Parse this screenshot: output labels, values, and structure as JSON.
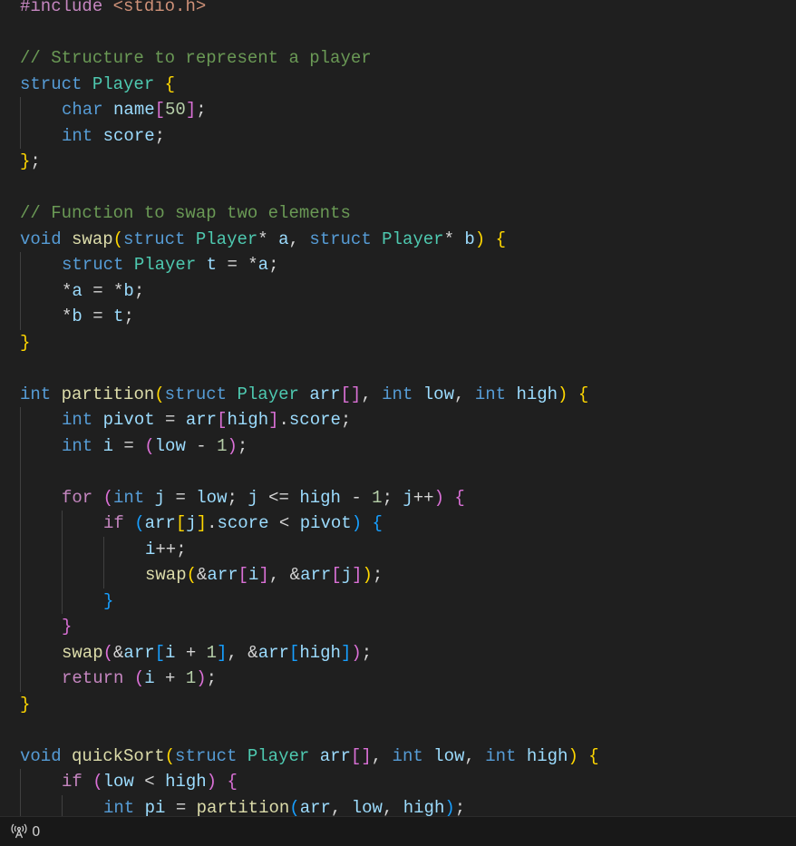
{
  "editor": {
    "lines": [
      [
        [
          "#include",
          "c"
        ],
        [
          " ",
          "p"
        ],
        [
          "<stdio.h>",
          "s"
        ]
      ],
      [],
      [
        [
          "// Structure to represent a player",
          "cm"
        ]
      ],
      [
        [
          "struct",
          "k"
        ],
        [
          " ",
          "p"
        ],
        [
          "Player",
          "t"
        ],
        [
          " ",
          "p"
        ],
        [
          "{",
          "b1"
        ]
      ],
      [
        [
          "    ",
          "i"
        ],
        [
          "char",
          "k"
        ],
        [
          " ",
          "p"
        ],
        [
          "name",
          "v"
        ],
        [
          "[",
          "b2"
        ],
        [
          "50",
          "n"
        ],
        [
          "]",
          "b2"
        ],
        [
          ";",
          "p"
        ]
      ],
      [
        [
          "    ",
          "i"
        ],
        [
          "int",
          "k"
        ],
        [
          " ",
          "p"
        ],
        [
          "score",
          "v"
        ],
        [
          ";",
          "p"
        ]
      ],
      [
        [
          "}",
          "b1"
        ],
        [
          ";",
          "p"
        ]
      ],
      [],
      [
        [
          "// Function to swap two elements",
          "cm"
        ]
      ],
      [
        [
          "void",
          "k"
        ],
        [
          " ",
          "p"
        ],
        [
          "swap",
          "f"
        ],
        [
          "(",
          "b1"
        ],
        [
          "struct",
          "k"
        ],
        [
          " ",
          "p"
        ],
        [
          "Player",
          "t"
        ],
        [
          "* ",
          "p"
        ],
        [
          "a",
          "v"
        ],
        [
          ", ",
          "p"
        ],
        [
          "struct",
          "k"
        ],
        [
          " ",
          "p"
        ],
        [
          "Player",
          "t"
        ],
        [
          "* ",
          "p"
        ],
        [
          "b",
          "v"
        ],
        [
          ")",
          "b1"
        ],
        [
          " ",
          "p"
        ],
        [
          "{",
          "b1"
        ]
      ],
      [
        [
          "    ",
          "i"
        ],
        [
          "struct",
          "k"
        ],
        [
          " ",
          "p"
        ],
        [
          "Player",
          "t"
        ],
        [
          " ",
          "p"
        ],
        [
          "t",
          "v"
        ],
        [
          " = *",
          "p"
        ],
        [
          "a",
          "v"
        ],
        [
          ";",
          "p"
        ]
      ],
      [
        [
          "    ",
          "i"
        ],
        [
          "*",
          "p"
        ],
        [
          "a",
          "v"
        ],
        [
          " = *",
          "p"
        ],
        [
          "b",
          "v"
        ],
        [
          ";",
          "p"
        ]
      ],
      [
        [
          "    ",
          "i"
        ],
        [
          "*",
          "p"
        ],
        [
          "b",
          "v"
        ],
        [
          " = ",
          "p"
        ],
        [
          "t",
          "v"
        ],
        [
          ";",
          "p"
        ]
      ],
      [
        [
          "}",
          "b1"
        ]
      ],
      [],
      [
        [
          "int",
          "k"
        ],
        [
          " ",
          "p"
        ],
        [
          "partition",
          "f"
        ],
        [
          "(",
          "b1"
        ],
        [
          "struct",
          "k"
        ],
        [
          " ",
          "p"
        ],
        [
          "Player",
          "t"
        ],
        [
          " ",
          "p"
        ],
        [
          "arr",
          "v"
        ],
        [
          "[]",
          "b2"
        ],
        [
          ", ",
          "p"
        ],
        [
          "int",
          "k"
        ],
        [
          " ",
          "p"
        ],
        [
          "low",
          "v"
        ],
        [
          ", ",
          "p"
        ],
        [
          "int",
          "k"
        ],
        [
          " ",
          "p"
        ],
        [
          "high",
          "v"
        ],
        [
          ")",
          "b1"
        ],
        [
          " ",
          "p"
        ],
        [
          "{",
          "b1"
        ]
      ],
      [
        [
          "    ",
          "i"
        ],
        [
          "int",
          "k"
        ],
        [
          " ",
          "p"
        ],
        [
          "pivot",
          "v"
        ],
        [
          " = ",
          "p"
        ],
        [
          "arr",
          "v"
        ],
        [
          "[",
          "b2"
        ],
        [
          "high",
          "v"
        ],
        [
          "]",
          "b2"
        ],
        [
          ".",
          "p"
        ],
        [
          "score",
          "v"
        ],
        [
          ";",
          "p"
        ]
      ],
      [
        [
          "    ",
          "i"
        ],
        [
          "int",
          "k"
        ],
        [
          " ",
          "p"
        ],
        [
          "i",
          "v"
        ],
        [
          " = ",
          "p"
        ],
        [
          "(",
          "b2"
        ],
        [
          "low",
          "v"
        ],
        [
          " - ",
          "p"
        ],
        [
          "1",
          "n"
        ],
        [
          ")",
          "b2"
        ],
        [
          ";",
          "p"
        ]
      ],
      [
        [
          "    ",
          "i"
        ]
      ],
      [
        [
          "    ",
          "i"
        ],
        [
          "for",
          "c"
        ],
        [
          " ",
          "p"
        ],
        [
          "(",
          "b2"
        ],
        [
          "int",
          "k"
        ],
        [
          " ",
          "p"
        ],
        [
          "j",
          "v"
        ],
        [
          " = ",
          "p"
        ],
        [
          "low",
          "v"
        ],
        [
          "; ",
          "p"
        ],
        [
          "j",
          "v"
        ],
        [
          " <= ",
          "p"
        ],
        [
          "high",
          "v"
        ],
        [
          " - ",
          "p"
        ],
        [
          "1",
          "n"
        ],
        [
          "; ",
          "p"
        ],
        [
          "j",
          "v"
        ],
        [
          "++",
          "p"
        ],
        [
          ")",
          "b2"
        ],
        [
          " ",
          "p"
        ],
        [
          "{",
          "b2"
        ]
      ],
      [
        [
          "    ",
          "i"
        ],
        [
          "    ",
          "i"
        ],
        [
          "if",
          "c"
        ],
        [
          " ",
          "p"
        ],
        [
          "(",
          "b3"
        ],
        [
          "arr",
          "v"
        ],
        [
          "[",
          "b1"
        ],
        [
          "j",
          "v"
        ],
        [
          "]",
          "b1"
        ],
        [
          ".",
          "p"
        ],
        [
          "score",
          "v"
        ],
        [
          " < ",
          "p"
        ],
        [
          "pivot",
          "v"
        ],
        [
          ")",
          "b3"
        ],
        [
          " ",
          "p"
        ],
        [
          "{",
          "b3"
        ]
      ],
      [
        [
          "    ",
          "i"
        ],
        [
          "    ",
          "i"
        ],
        [
          "    ",
          "i"
        ],
        [
          "i",
          "v"
        ],
        [
          "++;",
          "p"
        ]
      ],
      [
        [
          "    ",
          "i"
        ],
        [
          "    ",
          "i"
        ],
        [
          "    ",
          "i"
        ],
        [
          "swap",
          "f"
        ],
        [
          "(",
          "b1"
        ],
        [
          "&",
          "p"
        ],
        [
          "arr",
          "v"
        ],
        [
          "[",
          "b2"
        ],
        [
          "i",
          "v"
        ],
        [
          "]",
          "b2"
        ],
        [
          ", &",
          "p"
        ],
        [
          "arr",
          "v"
        ],
        [
          "[",
          "b2"
        ],
        [
          "j",
          "v"
        ],
        [
          "]",
          "b2"
        ],
        [
          ")",
          "b1"
        ],
        [
          ";",
          "p"
        ]
      ],
      [
        [
          "    ",
          "i"
        ],
        [
          "    ",
          "i"
        ],
        [
          "}",
          "b3"
        ]
      ],
      [
        [
          "    ",
          "i"
        ],
        [
          "}",
          "b2"
        ]
      ],
      [
        [
          "    ",
          "i"
        ],
        [
          "swap",
          "f"
        ],
        [
          "(",
          "b2"
        ],
        [
          "&",
          "p"
        ],
        [
          "arr",
          "v"
        ],
        [
          "[",
          "b3"
        ],
        [
          "i",
          "v"
        ],
        [
          " + ",
          "p"
        ],
        [
          "1",
          "n"
        ],
        [
          "]",
          "b3"
        ],
        [
          ", &",
          "p"
        ],
        [
          "arr",
          "v"
        ],
        [
          "[",
          "b3"
        ],
        [
          "high",
          "v"
        ],
        [
          "]",
          "b3"
        ],
        [
          ")",
          "b2"
        ],
        [
          ";",
          "p"
        ]
      ],
      [
        [
          "    ",
          "i"
        ],
        [
          "return",
          "c"
        ],
        [
          " ",
          "p"
        ],
        [
          "(",
          "b2"
        ],
        [
          "i",
          "v"
        ],
        [
          " + ",
          "p"
        ],
        [
          "1",
          "n"
        ],
        [
          ")",
          "b2"
        ],
        [
          ";",
          "p"
        ]
      ],
      [
        [
          "}",
          "b1"
        ]
      ],
      [],
      [
        [
          "void",
          "k"
        ],
        [
          " ",
          "p"
        ],
        [
          "quickSort",
          "f"
        ],
        [
          "(",
          "b1"
        ],
        [
          "struct",
          "k"
        ],
        [
          " ",
          "p"
        ],
        [
          "Player",
          "t"
        ],
        [
          " ",
          "p"
        ],
        [
          "arr",
          "v"
        ],
        [
          "[]",
          "b2"
        ],
        [
          ", ",
          "p"
        ],
        [
          "int",
          "k"
        ],
        [
          " ",
          "p"
        ],
        [
          "low",
          "v"
        ],
        [
          ", ",
          "p"
        ],
        [
          "int",
          "k"
        ],
        [
          " ",
          "p"
        ],
        [
          "high",
          "v"
        ],
        [
          ")",
          "b1"
        ],
        [
          " ",
          "p"
        ],
        [
          "{",
          "b1"
        ]
      ],
      [
        [
          "    ",
          "i"
        ],
        [
          "if",
          "c"
        ],
        [
          " ",
          "p"
        ],
        [
          "(",
          "b2"
        ],
        [
          "low",
          "v"
        ],
        [
          " < ",
          "p"
        ],
        [
          "high",
          "v"
        ],
        [
          ")",
          "b2"
        ],
        [
          " ",
          "p"
        ],
        [
          "{",
          "b2"
        ]
      ],
      [
        [
          "    ",
          "i"
        ],
        [
          "    ",
          "i"
        ],
        [
          "int",
          "k"
        ],
        [
          " ",
          "p"
        ],
        [
          "pi",
          "v"
        ],
        [
          " = ",
          "p"
        ],
        [
          "partition",
          "f"
        ],
        [
          "(",
          "b3"
        ],
        [
          "arr",
          "v"
        ],
        [
          ", ",
          "p"
        ],
        [
          "low",
          "v"
        ],
        [
          ", ",
          "p"
        ],
        [
          "high",
          "v"
        ],
        [
          ")",
          "b3"
        ],
        [
          ";",
          "p"
        ]
      ]
    ]
  },
  "status_bar": {
    "ports_icon": "broadcast-antenna-icon",
    "ports_count": "0"
  }
}
